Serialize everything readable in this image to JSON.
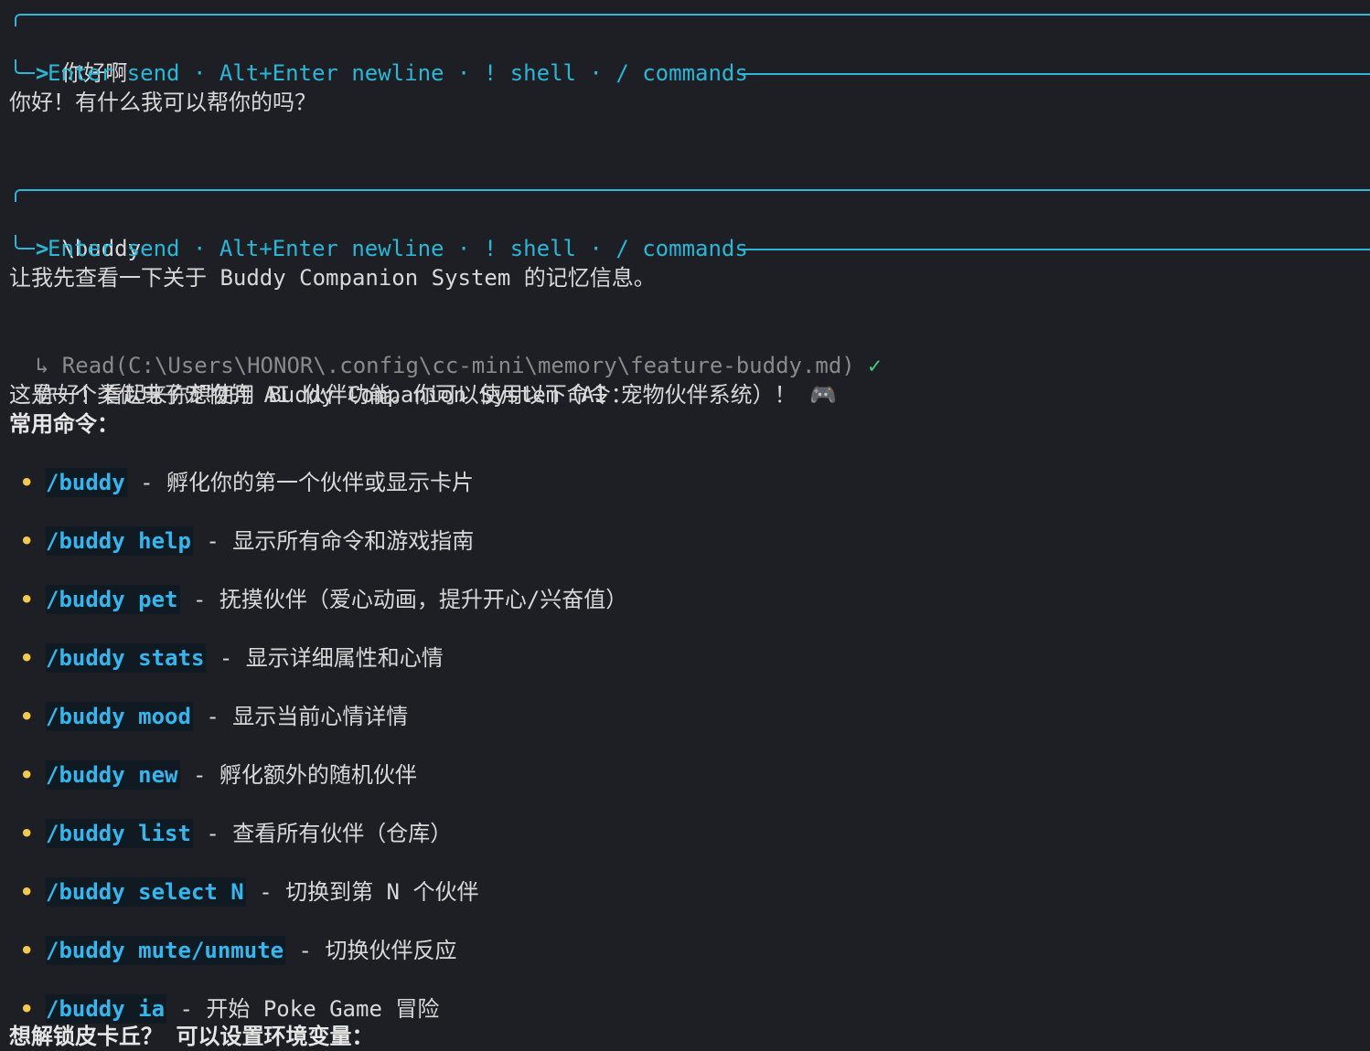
{
  "turn1": {
    "prompt_symbol": ">",
    "prompt": "你好啊",
    "hint": "Enter send · Alt+Enter newline · ! shell · / commands",
    "reply": "你好！有什么我可以帮你的吗？"
  },
  "turn2": {
    "prompt_symbol": ">",
    "prompt": "\\buddy",
    "hint": "Enter send · Alt+Enter newline · ! shell · / commands",
    "line1": "让我先查看一下关于 Buddy Companion System 的记忆信息。",
    "tool_call": "↳ Read(C:\\Users\\HONOR\\.config\\cc-mini\\memory\\feature-buddy.md)",
    "tool_status": "✓",
    "line2": "你好！看起来你想使用 Buddy Companion System（AI 宠物伙伴系统）！",
    "line2_icon": "🎮",
    "line3": "这是一个类似电子宠物的 AI 伙伴功能。你可以使用以下命令：",
    "section_title": "常用命令：",
    "bullet_symbol": "•",
    "commands": [
      {
        "cmd": "/buddy",
        "desc": "- 孵化你的第一个伙伴或显示卡片"
      },
      {
        "cmd": "/buddy help",
        "desc": "- 显示所有命令和游戏指南"
      },
      {
        "cmd": "/buddy pet",
        "desc": "- 抚摸伙伴（爱心动画，提升开心/兴奋值）"
      },
      {
        "cmd": "/buddy stats",
        "desc": "- 显示详细属性和心情"
      },
      {
        "cmd": "/buddy mood",
        "desc": "- 显示当前心情详情"
      },
      {
        "cmd": "/buddy new",
        "desc": "- 孵化额外的随机伙伴"
      },
      {
        "cmd": "/buddy list",
        "desc": "- 查看所有伙伴（仓库）"
      },
      {
        "cmd": "/buddy select N",
        "desc": "- 切换到第 N 个伙伴"
      },
      {
        "cmd": "/buddy mute/unmute",
        "desc": "- 切换伙伴反应"
      },
      {
        "cmd": "/buddy ia",
        "desc": "- 开始 Poke Game 冒险"
      }
    ],
    "footer": "想解锁皮卡丘？ 可以设置环境变量："
  }
}
